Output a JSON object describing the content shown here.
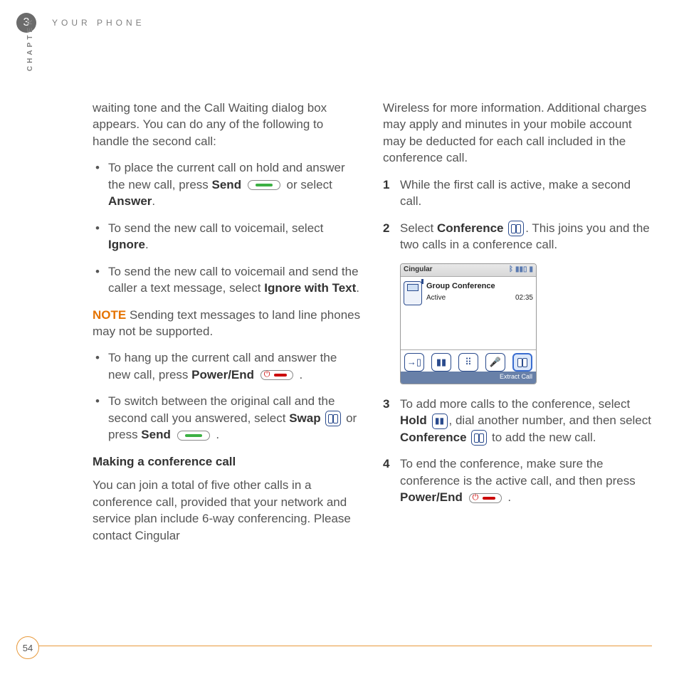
{
  "header": {
    "chapter_number": "3",
    "running_head": "YOUR PHONE",
    "side_label": "CHAPTER"
  },
  "left_column": {
    "p1": "waiting tone and the Call Waiting dialog box appears. You can do any of the following to handle the second call:",
    "bullets_a": [
      {
        "pre": "To place the current call on hold and answer the new call, press ",
        "b1": "Send",
        "mid": " or select ",
        "b2": "Answer",
        "post": "."
      },
      {
        "pre": "To send the new call to voicemail, select ",
        "b1": "Ignore",
        "post": "."
      },
      {
        "pre": "To send the new call to voicemail and send the caller a text message, select ",
        "b1": "Ignore with Text",
        "post": "."
      }
    ],
    "note_label": "NOTE",
    "note_text": " Sending text messages to land line phones may not be supported.",
    "bullets_b": [
      {
        "pre": "To hang up the current call and answer the new call, press ",
        "b1": "Power/End",
        "post": " ."
      },
      {
        "pre": "To switch between the original call and the second call you answered, select ",
        "b1": "Swap",
        "mid": " or press ",
        "b2": "Send",
        "post": " ."
      }
    ],
    "subhead": "Making a conference call",
    "p2": "You can join a total of five other calls in a conference call, provided that your network and service plan include 6-way conferencing. Please contact Cingular"
  },
  "right_column": {
    "p1": "Wireless for more information. Additional charges may apply and minutes in your mobile account may be deducted for each call included in the conference call.",
    "steps": [
      {
        "n": "1",
        "pre": "While the first call is active, make a second call."
      },
      {
        "n": "2",
        "pre": "Select ",
        "b1": "Conference",
        "post": ". This joins you and the two calls in a conference call."
      },
      {
        "n": "3",
        "pre": "To add more calls to the conference, select ",
        "b1": "Hold",
        "mid": ", dial another number, and then select ",
        "b2": "Conference",
        "post": " to add the new call."
      },
      {
        "n": "4",
        "pre": "To end the conference, make sure the conference is the active call, and then press ",
        "b1": "Power/End",
        "post": " ."
      }
    ]
  },
  "phone_screenshot": {
    "carrier": "Cingular",
    "title": "Group Conference",
    "status": "Active",
    "duration": "02:35",
    "selected_caption": "Extract Call"
  },
  "footer": {
    "page_number": "54"
  },
  "icons": {
    "send": "send-button",
    "power_end": "power-end-button",
    "swap": "swap-button",
    "conference": "conference-button",
    "hold": "hold-button"
  }
}
